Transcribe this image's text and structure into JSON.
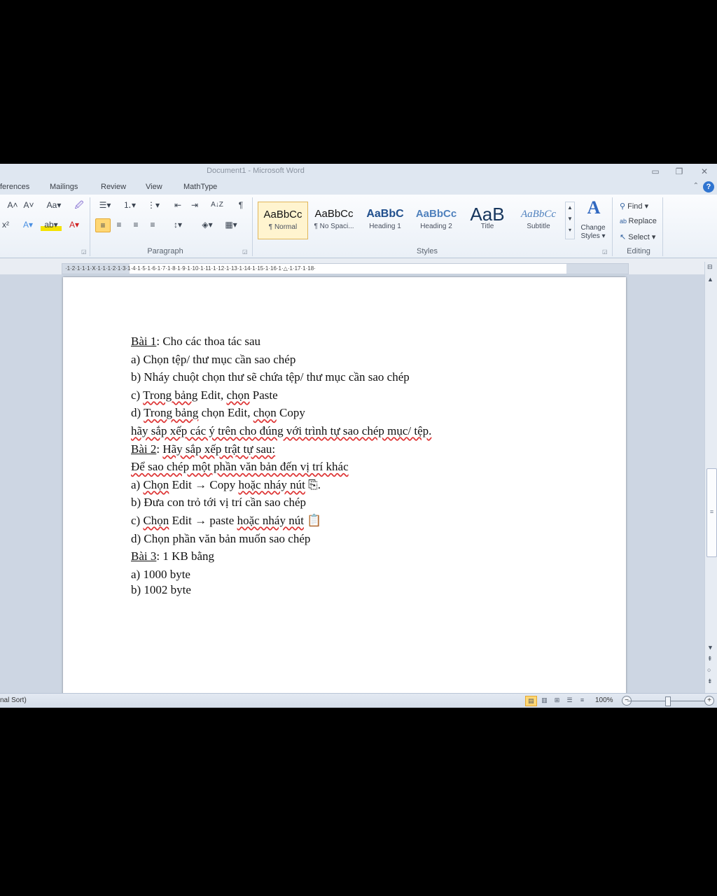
{
  "window": {
    "title": "Document1  -  Microsoft Word",
    "minimize": "▭",
    "restore": "❐",
    "close": "✕"
  },
  "tabs": [
    "ferences",
    "Mailings",
    "Review",
    "View",
    "MathType"
  ],
  "help_label": "?",
  "ribbon_min_icon": "⌃",
  "ribbon": {
    "font_group": {
      "grow_font": "A˄",
      "shrink_font": "A˅",
      "change_case": "Aa▾",
      "clear_format": "🖉",
      "superscript": "x²",
      "text_effects": "A▾",
      "highlight": "ab▾",
      "font_color": "A▾"
    },
    "paragraph": {
      "label": "Paragraph",
      "bullets": "☰▾",
      "numbering": "⒈▾",
      "multilevel": "⋮▾",
      "decrease_indent": "⇤",
      "increase_indent": "⇥",
      "sort": "A↓Z",
      "show_marks": "¶",
      "align_left": "≡",
      "align_center": "≡",
      "align_right": "≡",
      "justify": "≡",
      "line_spacing": "↕▾",
      "shading": "◈▾",
      "borders": "▦▾"
    },
    "styles": {
      "label": "Styles",
      "items": [
        {
          "preview": "AaBbCc",
          "name": "¶ Normal"
        },
        {
          "preview": "AaBbCc",
          "name": "¶ No Spaci..."
        },
        {
          "preview": "AaBbC",
          "name": "Heading 1"
        },
        {
          "preview": "AaBbCc",
          "name": "Heading 2"
        },
        {
          "preview": "AaB",
          "name": "Title"
        },
        {
          "preview": "AaBbCc",
          "name": "Subtitle"
        }
      ],
      "change_styles_icon": "A",
      "change_styles_label": "Change",
      "change_styles_label2": "Styles ▾"
    },
    "editing": {
      "label": "Editing",
      "find": "Find ▾",
      "replace": "Replace",
      "select": "Select ▾"
    }
  },
  "ruler": "·1·2·1·1·1·Ⅹ·1·1·1·2·1·3·1·4·1·5·1·6·1·7·1·8·1·9·1·10·1·11·1·12·1·13·1·14·1·15·1·16·1·△·1·17·1·18·",
  "document": {
    "lines": [
      [
        {
          "t": "Bài 1",
          "c": "u"
        },
        {
          "t": ": Cho các thoa tác sau"
        }
      ],
      [
        {
          "t": "a) Chọn tệp/ thư mục cần sao chép"
        }
      ],
      [
        {
          "t": "b) Nháy chuột chọn thư sẽ chứa tệp/ thư mục cần sao chép"
        }
      ],
      [
        {
          "t": "c) "
        },
        {
          "t": "Trong bảng",
          "c": "sq"
        },
        {
          "t": " Edit, "
        },
        {
          "t": "chọn",
          "c": "sq"
        },
        {
          "t": " Paste"
        }
      ],
      [
        {
          "t": "d) "
        },
        {
          "t": "Trong bảng",
          "c": "sq"
        },
        {
          "t": " chọn Edit, "
        },
        {
          "t": "chọn",
          "c": "sq"
        },
        {
          "t": " Copy"
        }
      ],
      [
        {
          "t": "hãy sắp xếp các ý trên cho đúng với trình tự sao chép mục/ tệp.",
          "c": "sq"
        }
      ],
      [
        {
          "t": "Bài 2",
          "c": "u"
        },
        {
          "t": ": "
        },
        {
          "t": "Hãy sắp xếp trật tự sau:",
          "c": "sq"
        }
      ],
      [
        {
          "t": "Để sao chép một phần văn bản đến vị trí khác",
          "c": "sq"
        }
      ],
      [
        {
          "t": "a) "
        },
        {
          "t": "Chọn",
          "c": "sq"
        },
        {
          "t": " Edit → Copy "
        },
        {
          "t": "hoặc nháy nút",
          "c": "sq"
        },
        {
          "t": " ⎘."
        }
      ],
      [
        {
          "t": "b) Đưa con trỏ tới vị trí cần sao chép"
        }
      ],
      [
        {
          "t": "c) "
        },
        {
          "t": "Chọn",
          "c": "sq"
        },
        {
          "t": " Edit → paste "
        },
        {
          "t": "hoặc nháy nút",
          "c": "sq"
        },
        {
          "t": " 📋"
        }
      ],
      [
        {
          "t": "d) Chọn phần văn bản muốn sao chép"
        }
      ],
      [
        {
          "t": "Bài 3",
          "c": "u"
        },
        {
          "t": ": 1 KB bằng"
        }
      ],
      [
        {
          "t": "a) 1000 byte"
        }
      ],
      [
        {
          "t": "b) 1002 byte"
        }
      ]
    ]
  },
  "statusbar": {
    "left": "nal Sort)",
    "zoom": "100%",
    "zoom_out": "−",
    "zoom_in": "+",
    "zoom_level_pct": 100
  },
  "scrollbar": {
    "up": "▲",
    "down": "▼",
    "prev": "⇞",
    "select_browse": "○",
    "next": "⇟",
    "grip": "≡",
    "ruler_toggle": "⊟"
  }
}
